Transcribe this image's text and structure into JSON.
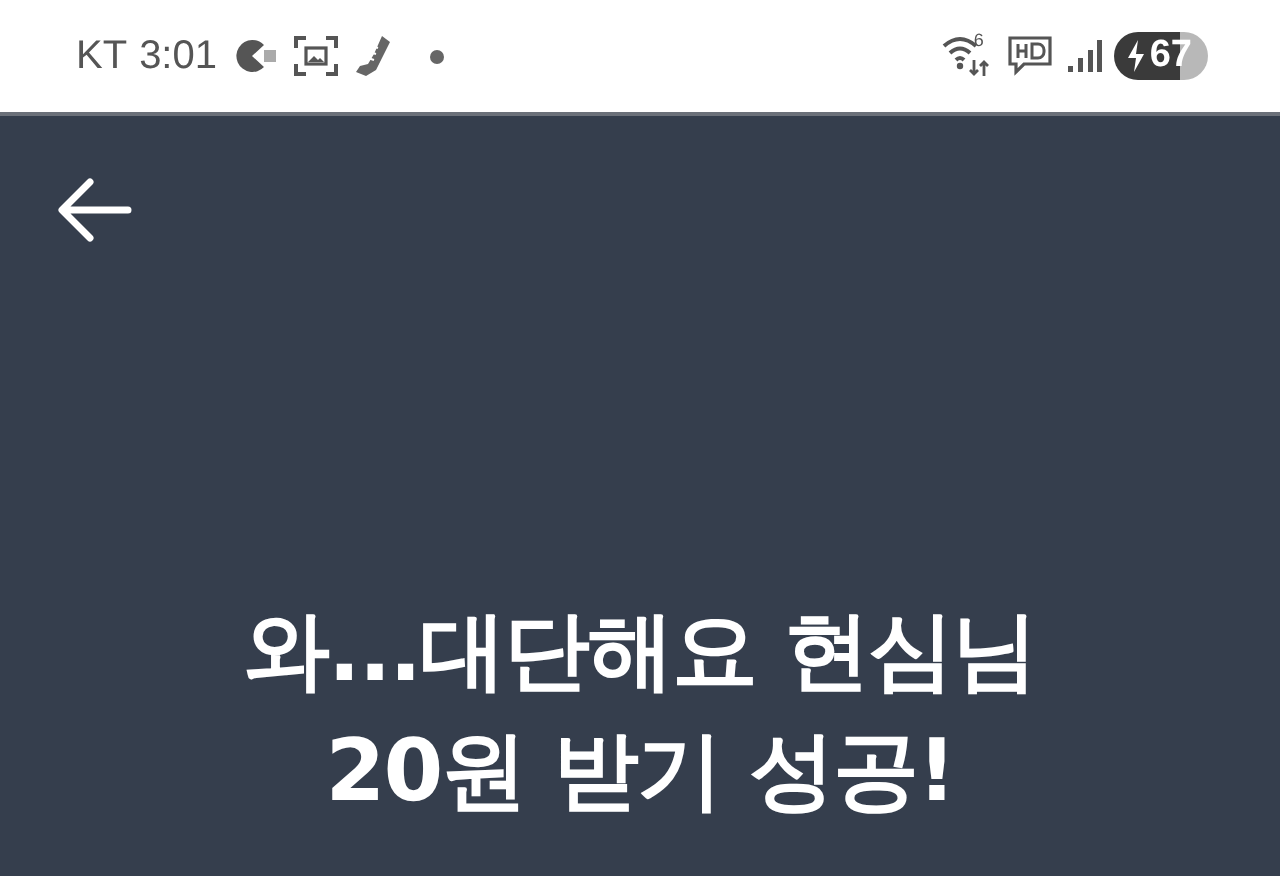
{
  "status_bar": {
    "carrier": "KT",
    "time": "3:01",
    "wifi_badge": "6",
    "battery": "67"
  },
  "title_lines": [
    "와...대단해요 현심님",
    "20원 받기 성공!"
  ]
}
